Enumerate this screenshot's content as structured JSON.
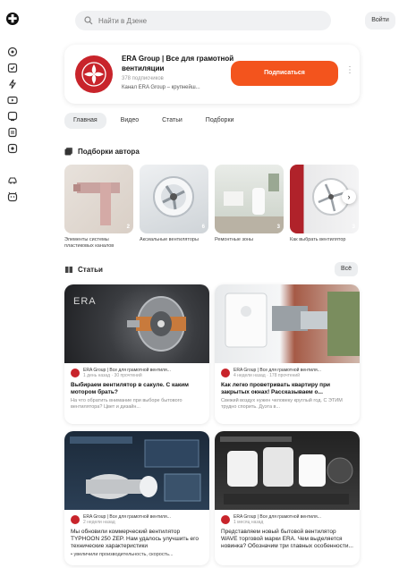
{
  "header": {
    "search_placeholder": "Найти в Дзене",
    "login_label": "Войти"
  },
  "channel": {
    "name": "ERA Group | Все для грамотной вентиляции",
    "subscribers": "378 подписчиков",
    "description": "Канал ERA Group – крупнейш...",
    "subscribe_label": "Подписаться",
    "more": "⋮",
    "brand_color": "#c8242b",
    "accent_color": "#f3541d"
  },
  "tabs": [
    {
      "label": "Главная",
      "active": true
    },
    {
      "label": "Видео",
      "active": false
    },
    {
      "label": "Статьи",
      "active": false
    },
    {
      "label": "Подборки",
      "active": false
    }
  ],
  "collections": {
    "title": "Подборки автора",
    "next": "›",
    "items": [
      {
        "label": "Элементы системы пластиковых каналов",
        "count": "2"
      },
      {
        "label": "Аксиальные вентиляторы",
        "count": "6"
      },
      {
        "label": "Ремонтные зоны",
        "count": "3"
      },
      {
        "label": "Как выбрать вентилятор",
        "count": "3"
      }
    ]
  },
  "articles": {
    "title": "Статьи",
    "all_label": "Всё",
    "items": [
      {
        "author": "ERA Group | Все для грамотной вентиля...",
        "time": "1 день назад · 30 прочтений",
        "title": "Выбираем вентилятор в сакуле. С каким мотором брать?",
        "snippet": "На что обратить внимание при выборе бытового вентилятора? Цвет и дизайн...",
        "img_label": "ERA"
      },
      {
        "author": "ERA Group | Все для грамотной вентиля...",
        "time": "4 недели назад · 178 прочтений",
        "title": "Как легко проветривать квартиру при закрытых окнах! Рассказываем о...",
        "snippet": "Свежий воздух нужен человеку круглый год. С ЭТИМ трудно спорить. Дуэта в...",
        "img_label": ""
      },
      {
        "author": "ERA Group | Все для грамотной вентиля...",
        "time": "2 недели назад",
        "title": "Мы обновили коммерческий вентилятор TYPHOON 250 ZEP. Нам удалось улучшить его технические характеристики",
        "snippet": "• увеличили производительность, скорость...",
        "img_label": ""
      },
      {
        "author": "ERA Group | Все для грамотной вентиля...",
        "time": "1 месяц назад",
        "title": "Представляем новый бытовой вентилятор WAVE торговой марки ERA. Чем выделяется новинка? Обозначим три главных особенности...",
        "snippet": "",
        "img_label": ""
      }
    ]
  }
}
